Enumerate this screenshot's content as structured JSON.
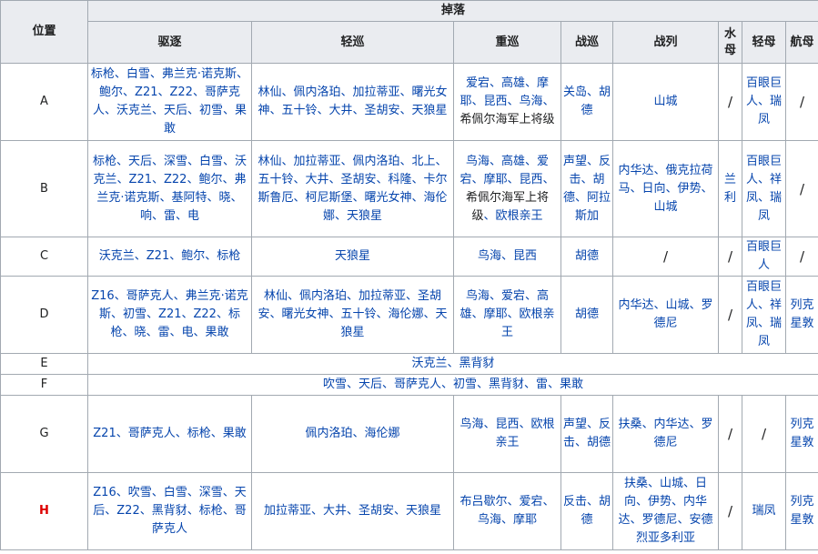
{
  "headers": {
    "position": "位置",
    "drops": "掉落",
    "dd": "驱逐",
    "cl": "轻巡",
    "ca": "重巡",
    "bc": "战巡",
    "bb": "战列",
    "av": "水母",
    "cvl": "轻母",
    "cv": "航母"
  },
  "rows": {
    "a": {
      "pos": "A",
      "dd": "标枪、白雪、弗兰克·诺克斯、鲍尔、Z21、Z22、哥萨克人、沃克兰、天后、初雪、果敢",
      "cl": "林仙、佩内洛珀、加拉蒂亚、曙光女神、五十铃、大井、圣胡安、天狼星",
      "ca_link": "爱宕、高雄、摩耶、昆西、鸟海、",
      "ca_plain": "希佩尔海军上将级",
      "bc": "关岛、胡德",
      "bb": "山城",
      "av": "/",
      "cvl": "百眼巨人、瑞凤",
      "cv": "/"
    },
    "b": {
      "pos": "B",
      "dd": "标枪、天后、深雪、白雪、沃克兰、Z21、Z22、鲍尔、弗兰克·诺克斯、基阿特、晓、响、雷、电",
      "cl": "林仙、加拉蒂亚、佩内洛珀、北上、五十铃、大井、圣胡安、科隆、卡尔斯鲁厄、柯尼斯堡、曙光女神、海伦娜、天狼星",
      "ca_link1": "鸟海、高雄、爱宕、摩耶、昆西、",
      "ca_plain": "希佩尔海军上将级",
      "ca_link2": "、欧根亲王",
      "bc": "声望、反击、胡德、阿拉斯加",
      "bb": "内华达、俄克拉荷马、日向、伊势、山城",
      "av": "兰利",
      "cvl": "百眼巨人、祥凤、瑞凤",
      "cv": "/"
    },
    "c": {
      "pos": "C",
      "dd": "沃克兰、Z21、鲍尔、标枪",
      "cl": "天狼星",
      "ca": "鸟海、昆西",
      "bc": "胡德",
      "bb": "/",
      "av": "/",
      "cvl": "百眼巨人",
      "cv": "/"
    },
    "d": {
      "pos": "D",
      "dd": "Z16、哥萨克人、弗兰克·诺克斯、初雪、Z21、Z22、标枪、晓、雷、电、果敢",
      "cl": "林仙、佩内洛珀、加拉蒂亚、圣胡安、曙光女神、五十铃、海伦娜、天狼星",
      "ca": "鸟海、爱宕、高雄、摩耶、欧根亲王",
      "bc": "胡德",
      "bb": "内华达、山城、罗德尼",
      "av": "/",
      "cvl": "百眼巨人、祥凤、瑞凤",
      "cv": "列克星敦"
    },
    "e": {
      "pos": "E",
      "all": "沃克兰、黑背豺"
    },
    "f": {
      "pos": "F",
      "all": "吹雪、天后、哥萨克人、初雪、黑背豺、雷、果敢"
    },
    "g": {
      "pos": "G",
      "dd": "Z21、哥萨克人、标枪、果敢",
      "cl": "佩内洛珀、海伦娜",
      "ca": "鸟海、昆西、欧根亲王",
      "bc": "声望、反击、胡德",
      "bb": "扶桑、内华达、罗德尼",
      "av": "/",
      "cvl": "/",
      "cv": "列克星敦"
    },
    "h": {
      "pos": "H",
      "dd": "Z16、吹雪、白雪、深雪、天后、Z22、黑背豺、标枪、哥萨克人",
      "cl": "加拉蒂亚、大井、圣胡安、天狼星",
      "ca": "布吕歇尔、爱宕、鸟海、摩耶",
      "bc": "反击、胡德",
      "bb": "扶桑、山城、日向、伊势、内华达、罗德尼、安德烈亚多利亚",
      "av": "/",
      "cvl": "瑞凤",
      "cv": "列克星敦"
    }
  },
  "colors": {
    "link": "#0645ad",
    "header_bg": "#eaecf0",
    "border": "#a2a9b1",
    "highlight": "#dd0000"
  }
}
